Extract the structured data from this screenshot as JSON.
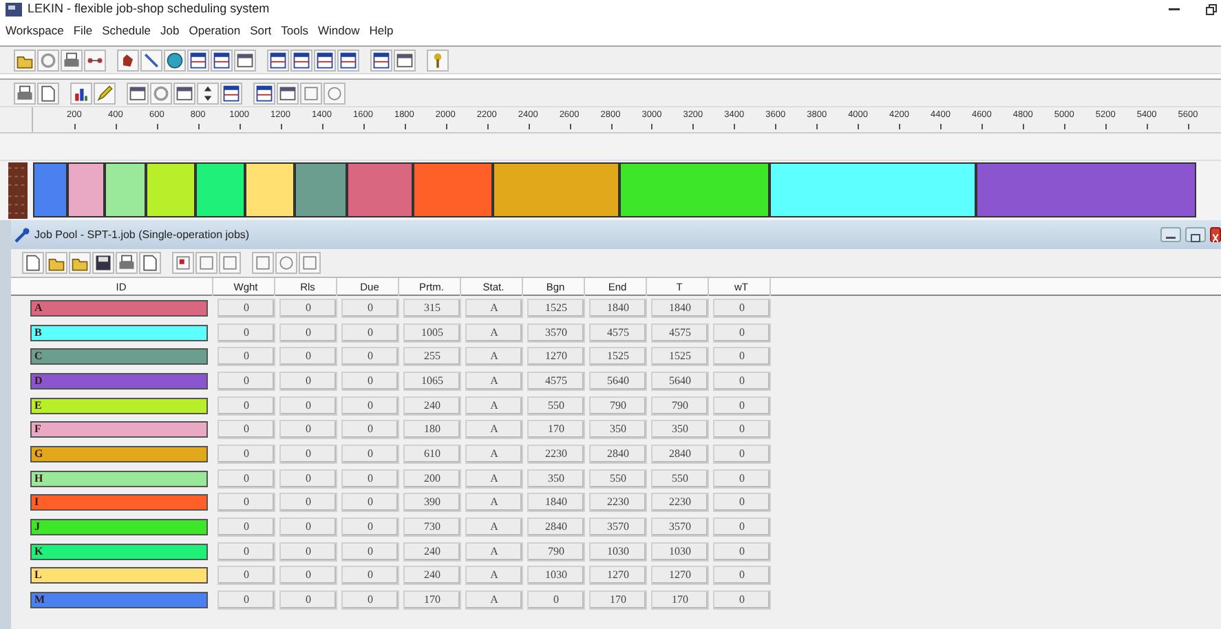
{
  "window": {
    "title": "LEKIN - flexible job-shop scheduling system"
  },
  "menu": [
    "Workspace",
    "File",
    "Schedule",
    "Job",
    "Operation",
    "Sort",
    "Tools",
    "Window",
    "Help"
  ],
  "ruler": [
    "200",
    "400",
    "600",
    "800",
    "1000",
    "1200",
    "1400",
    "1600",
    "1800",
    "2000",
    "2200",
    "2400",
    "2600",
    "2800",
    "3000",
    "3200",
    "3400",
    "3600",
    "3800",
    "4000",
    "4200",
    "4400",
    "4600",
    "4800",
    "5000",
    "5200",
    "5400",
    "5600"
  ],
  "job_pool": {
    "title": "Job Pool - SPT-1.job (Single-operation jobs)",
    "columns": [
      "ID",
      "Wght",
      "Rls",
      "Due",
      "Prtm.",
      "Stat.",
      "Bgn",
      "End",
      "T",
      "wT"
    ],
    "rows": [
      {
        "id": "A",
        "color": "#d9677f",
        "values": [
          "0",
          "0",
          "0",
          "315",
          "A",
          "1525",
          "1840",
          "1840",
          "0"
        ]
      },
      {
        "id": "B",
        "color": "#5effff",
        "values": [
          "0",
          "0",
          "0",
          "1005",
          "A",
          "3570",
          "4575",
          "4575",
          "0"
        ]
      },
      {
        "id": "C",
        "color": "#6b9e8e",
        "values": [
          "0",
          "0",
          "0",
          "255",
          "A",
          "1270",
          "1525",
          "1525",
          "0"
        ]
      },
      {
        "id": "D",
        "color": "#8c55d0",
        "values": [
          "0",
          "0",
          "0",
          "1065",
          "A",
          "4575",
          "5640",
          "5640",
          "0"
        ]
      },
      {
        "id": "E",
        "color": "#b8ee2a",
        "values": [
          "0",
          "0",
          "0",
          "240",
          "A",
          "550",
          "790",
          "790",
          "0"
        ]
      },
      {
        "id": "F",
        "color": "#e9a8c4",
        "values": [
          "0",
          "0",
          "0",
          "180",
          "A",
          "170",
          "350",
          "350",
          "0"
        ]
      },
      {
        "id": "G",
        "color": "#e0a81a",
        "values": [
          "0",
          "0",
          "0",
          "610",
          "A",
          "2230",
          "2840",
          "2840",
          "0"
        ]
      },
      {
        "id": "H",
        "color": "#9ae89a",
        "values": [
          "0",
          "0",
          "0",
          "200",
          "A",
          "350",
          "550",
          "550",
          "0"
        ]
      },
      {
        "id": "I",
        "color": "#ff6028",
        "values": [
          "0",
          "0",
          "0",
          "390",
          "A",
          "1840",
          "2230",
          "2230",
          "0"
        ]
      },
      {
        "id": "J",
        "color": "#3ee62a",
        "values": [
          "0",
          "0",
          "0",
          "730",
          "A",
          "2840",
          "3570",
          "3570",
          "0"
        ]
      },
      {
        "id": "K",
        "color": "#1ef07a",
        "values": [
          "0",
          "0",
          "0",
          "240",
          "A",
          "790",
          "1030",
          "1030",
          "0"
        ]
      },
      {
        "id": "L",
        "color": "#ffe070",
        "values": [
          "0",
          "0",
          "0",
          "240",
          "A",
          "1030",
          "1270",
          "1270",
          "0"
        ]
      },
      {
        "id": "M",
        "color": "#4a80f0",
        "values": [
          "0",
          "0",
          "0",
          "170",
          "A",
          "0",
          "170",
          "170",
          "0"
        ]
      }
    ]
  }
}
